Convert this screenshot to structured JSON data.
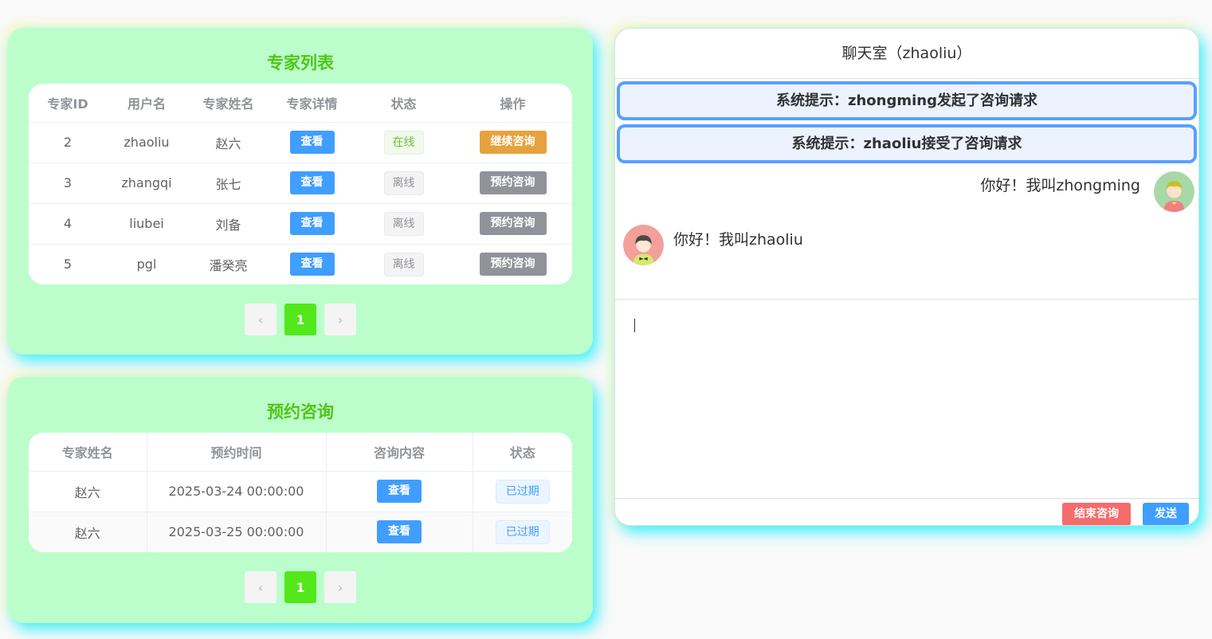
{
  "experts": {
    "title": "专家列表",
    "columns": [
      "专家ID",
      "用户名",
      "专家姓名",
      "专家详情",
      "状态",
      "操作"
    ],
    "rows": [
      {
        "id": "2",
        "username": "zhaoliu",
        "name": "赵六",
        "detail": "查看",
        "status": "在线",
        "action": "继续咨询"
      },
      {
        "id": "3",
        "username": "zhangqi",
        "name": "张七",
        "detail": "查看",
        "status": "离线",
        "action": "预约咨询"
      },
      {
        "id": "4",
        "username": "liubei",
        "name": "刘备",
        "detail": "查看",
        "status": "离线",
        "action": "预约咨询"
      },
      {
        "id": "5",
        "username": "pgl",
        "name": "潘癸亮",
        "detail": "查看",
        "status": "离线",
        "action": "预约咨询"
      }
    ],
    "pagination": {
      "prev": "‹",
      "current": "1",
      "next": "›"
    }
  },
  "reservations": {
    "title": "预约咨询",
    "columns": [
      "专家姓名",
      "预约时间",
      "咨询内容",
      "状态"
    ],
    "rows": [
      {
        "name": "赵六",
        "time": "2025-03-24 00:00:00",
        "content": "查看",
        "status": "已过期"
      },
      {
        "name": "赵六",
        "time": "2025-03-25 00:00:00",
        "content": "查看",
        "status": "已过期"
      }
    ],
    "pagination": {
      "prev": "‹",
      "current": "1",
      "next": "›"
    }
  },
  "chat": {
    "title": "聊天室（zhaoliu）",
    "system_messages": [
      "系统提示：zhongming发起了咨询请求",
      "系统提示：zhaoliu接受了咨询请求"
    ],
    "messages": [
      {
        "side": "right",
        "text": "你好！我叫zhongming"
      },
      {
        "side": "left",
        "text": "你好！我叫zhaoliu"
      }
    ],
    "input_value": "",
    "end_button": "结束咨询",
    "send_button": "发送"
  },
  "colors": {
    "card_bg": "#bbfecb",
    "title_green": "#52c41a",
    "primary": "#409eff",
    "warning": "#e6a23c",
    "info": "#909399",
    "danger": "#f56c6c",
    "page_active": "#52e81a"
  }
}
